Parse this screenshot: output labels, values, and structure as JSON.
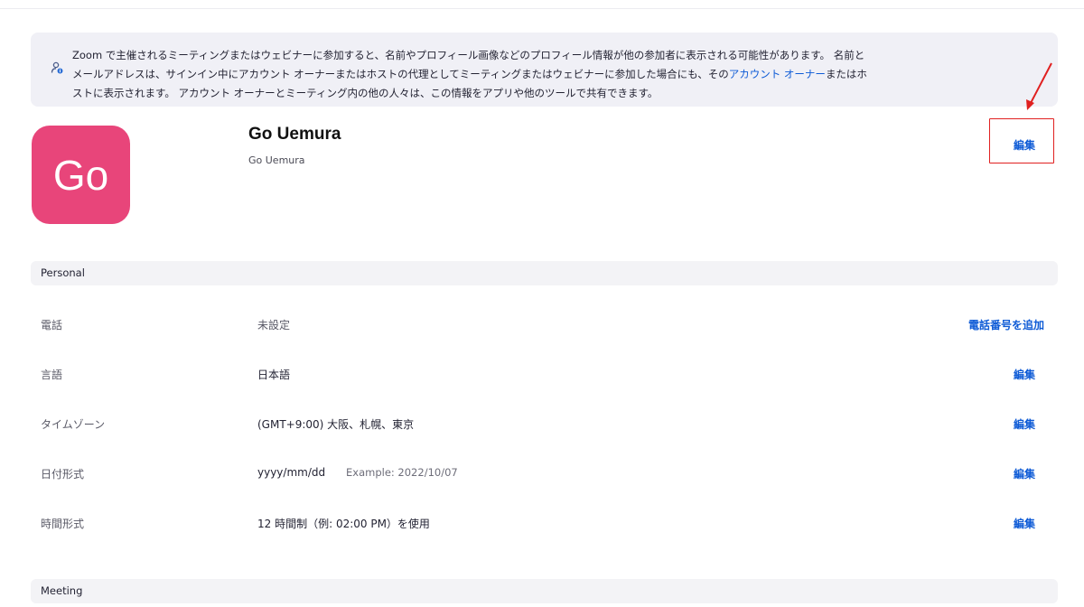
{
  "notice": {
    "line1": "Zoom で主催されるミーティングまたはウェビナーに参加すると、名前やプロフィール画像などのプロフィール情報が他の参加者に表示される可能性があります。 名前と",
    "line2_a": "メールアドレスは、サインイン中にアカウント オーナーまたはホストの代理としてミーティングまたはウェビナーに参加した場合にも、その",
    "line2_link": "アカウント オーナー",
    "line2_b": "またはホ",
    "line3": "ストに表示されます。 アカウント オーナーとミーティング内の他の人々は、この情報をアプリや他のツールで共有できます。",
    "icon": "user-info-icon"
  },
  "profile": {
    "avatar_initials": "Go",
    "avatar_color": "#e8457a",
    "name": "Go Uemura",
    "display_name": "Go Uemura",
    "edit_label": "編集"
  },
  "sections": {
    "personal": "Personal",
    "meeting": "Meeting"
  },
  "personal_rows": [
    {
      "label": "電話",
      "value": "未設定",
      "action": "電話番号を追加"
    },
    {
      "label": "言語",
      "value": "日本語",
      "action": "編集"
    },
    {
      "label": "タイムゾーン",
      "value": "(GMT+9:00) 大阪、札幌、東京",
      "action": "編集"
    },
    {
      "label": "日付形式",
      "value": "yyyy/mm/dd",
      "example": "Example: 2022/10/07",
      "action": "編集"
    },
    {
      "label": "時間形式",
      "value": "12 時間制（例: 02:00 PM）を使用",
      "action": "編集"
    }
  ],
  "colors": {
    "link": "#0e5bd6",
    "annotation": "#e02020",
    "notice_bg": "#f0f0f6"
  }
}
